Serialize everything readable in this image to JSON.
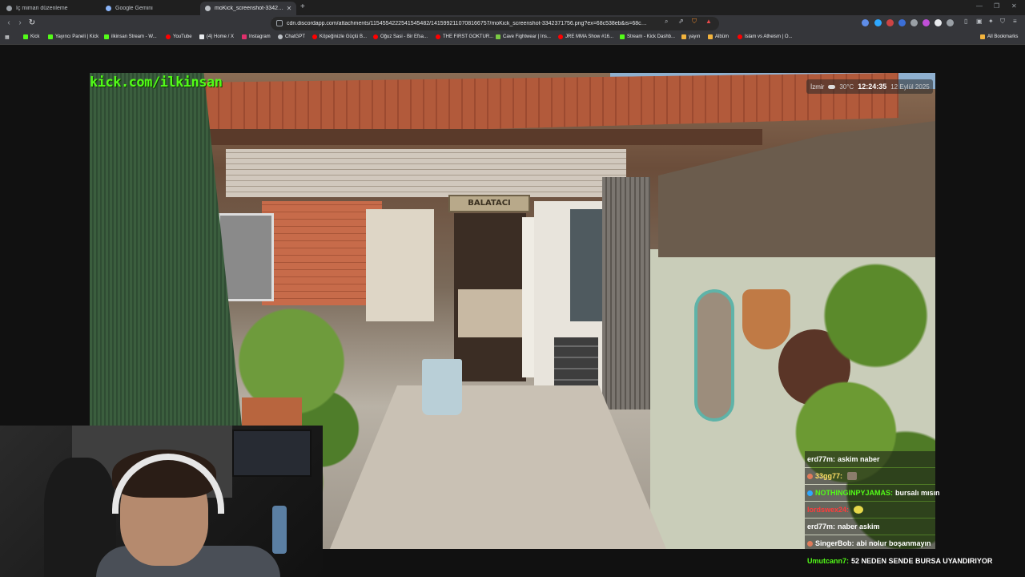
{
  "tabs": [
    {
      "label": "İç mimari düzenleme",
      "active": false
    },
    {
      "label": "Google Gemini",
      "active": false
    },
    {
      "label": "moKick_screenshot-3342371756...",
      "active": true
    }
  ],
  "omnibox": {
    "url": "cdn.discordapp.com/attachments/1154554222541545482/1415992110708166757/moKick_screenshot-3342371756.png?ex=68c538eb&is=68c3..."
  },
  "bookmarks": [
    {
      "label": "Kick",
      "color": "#53fc18"
    },
    {
      "label": "Yayıncı Paneli | Kick",
      "color": "#53fc18"
    },
    {
      "label": "ilkinsan Stream - W...",
      "color": "#53fc18"
    },
    {
      "label": "YouTube",
      "color": "#ff0000"
    },
    {
      "label": "(4) Home / X",
      "color": "#e8eaed"
    },
    {
      "label": "Instagram",
      "color": "#e1306c"
    },
    {
      "label": "ChatGPT",
      "color": "#bdc1c6"
    },
    {
      "label": "Köpeğinizle Güçlü B...",
      "color": "#ff0000"
    },
    {
      "label": "Oğuz Sasi - Bir Efsa...",
      "color": "#ff0000"
    },
    {
      "label": "THE FIRST GOKTUR...",
      "color": "#ff0000"
    },
    {
      "label": "Cave Fightwear | Ins...",
      "color": "#7ac943"
    },
    {
      "label": "JRE MMA Show #16...",
      "color": "#ff0000"
    },
    {
      "label": "Stream - Kick Dashb...",
      "color": "#53fc18"
    },
    {
      "label": "yayın",
      "color": "#f2b33d"
    },
    {
      "label": "Albüm",
      "color": "#f2b33d"
    },
    {
      "label": "Islam vs Atheism | O...",
      "color": "#ff0000"
    }
  ],
  "all_bookmarks": "All Bookmarks",
  "stream": {
    "handle": "kick.com/ilkinsan",
    "sign": "BALATACI",
    "weather": {
      "city": "İzmir",
      "temp": "30°C",
      "time": "12:24:35",
      "date": "12 Eylül 2025"
    }
  },
  "chat": [
    {
      "user": "erd77m:",
      "message": "askim naber",
      "user_color": "#ffffff",
      "badge": ""
    },
    {
      "user": "33gg77:",
      "message": "",
      "user_color": "#ffe066",
      "badge": "#e07b5a",
      "emote": true
    },
    {
      "user": "NOTHINGINPYJAMAS:",
      "message": "bursalı mısın",
      "user_color": "#53fc18",
      "badge": "#2ea8ff"
    },
    {
      "user": "lordswex24:",
      "message": "",
      "user_color": "#ff3b3b",
      "badge": "#e07b5a",
      "emote": true
    },
    {
      "user": "erd77m:",
      "message": "naber askim",
      "user_color": "#ffffff",
      "badge": ""
    },
    {
      "user": "SingerBob:",
      "message": "abi nolur boşanmayın",
      "user_color": "#ffffff",
      "badge": "#e07b5a"
    },
    {
      "user": "Umutcann7:",
      "message": "52 NEDEN SENDE BURSA UYANDIRIYOR",
      "user_color": "#53fc18",
      "badge": ""
    }
  ]
}
